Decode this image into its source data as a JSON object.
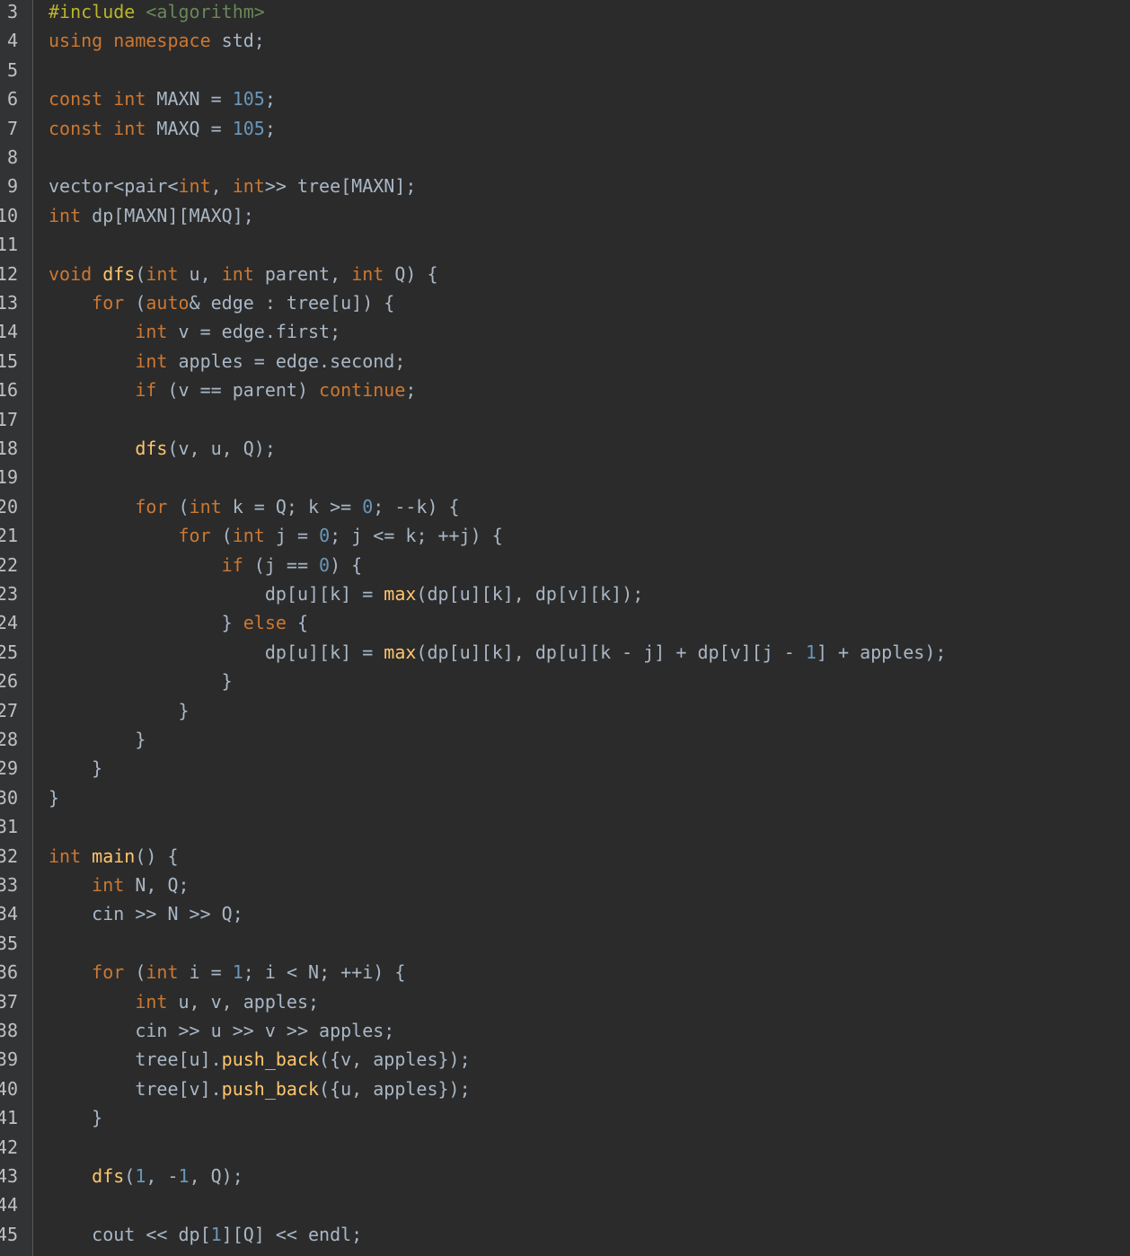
{
  "editor": {
    "line_numbers": [
      "3",
      "4",
      "5",
      "6",
      "7",
      "8",
      "9",
      "10",
      "11",
      "12",
      "13",
      "14",
      "15",
      "16",
      "17",
      "18",
      "19",
      "20",
      "21",
      "22",
      "23",
      "24",
      "25",
      "26",
      "27",
      "28",
      "29",
      "30",
      "31",
      "32",
      "33",
      "34",
      "35",
      "36",
      "37",
      "38",
      "39",
      "40",
      "41",
      "42",
      "43",
      "44",
      "45"
    ],
    "colors": {
      "background": "#2b2b2b",
      "gutter": "#313335",
      "keyword": "#cc7832",
      "number": "#6897bb",
      "function": "#ffc66d",
      "preprocessor": "#bbb529",
      "include_path": "#6a8759",
      "text": "#a9b7c6",
      "line_number": "#c0c0c0"
    },
    "lines": [
      [
        [
          "pre",
          "#include"
        ],
        [
          "txt",
          " "
        ],
        [
          "str",
          "<algorithm>"
        ]
      ],
      [
        [
          "kw",
          "using"
        ],
        [
          "txt",
          " "
        ],
        [
          "kw",
          "namespace"
        ],
        [
          "txt",
          " std;"
        ]
      ],
      [],
      [
        [
          "kw",
          "const"
        ],
        [
          "txt",
          " "
        ],
        [
          "kw",
          "int"
        ],
        [
          "txt",
          " MAXN = "
        ],
        [
          "num",
          "105"
        ],
        [
          "txt",
          ";"
        ]
      ],
      [
        [
          "kw",
          "const"
        ],
        [
          "txt",
          " "
        ],
        [
          "kw",
          "int"
        ],
        [
          "txt",
          " MAXQ = "
        ],
        [
          "num",
          "105"
        ],
        [
          "txt",
          ";"
        ]
      ],
      [],
      [
        [
          "txt",
          "vector<pair<"
        ],
        [
          "kw",
          "int"
        ],
        [
          "txt",
          ", "
        ],
        [
          "kw",
          "int"
        ],
        [
          "txt",
          ">> tree[MAXN];"
        ]
      ],
      [
        [
          "kw",
          "int"
        ],
        [
          "txt",
          " dp[MAXN][MAXQ];"
        ]
      ],
      [],
      [
        [
          "kw",
          "void"
        ],
        [
          "txt",
          " "
        ],
        [
          "fn",
          "dfs"
        ],
        [
          "txt",
          "("
        ],
        [
          "kw",
          "int"
        ],
        [
          "txt",
          " u, "
        ],
        [
          "kw",
          "int"
        ],
        [
          "txt",
          " parent, "
        ],
        [
          "kw",
          "int"
        ],
        [
          "txt",
          " Q) {"
        ]
      ],
      [
        [
          "txt",
          "    "
        ],
        [
          "kw",
          "for"
        ],
        [
          "txt",
          " ("
        ],
        [
          "kw",
          "auto"
        ],
        [
          "txt",
          "& edge : tree[u]) {"
        ]
      ],
      [
        [
          "txt",
          "        "
        ],
        [
          "kw",
          "int"
        ],
        [
          "txt",
          " v = edge.first;"
        ]
      ],
      [
        [
          "txt",
          "        "
        ],
        [
          "kw",
          "int"
        ],
        [
          "txt",
          " apples = edge.second;"
        ]
      ],
      [
        [
          "txt",
          "        "
        ],
        [
          "kw",
          "if"
        ],
        [
          "txt",
          " (v == parent) "
        ],
        [
          "kw",
          "continue"
        ],
        [
          "txt",
          ";"
        ]
      ],
      [],
      [
        [
          "txt",
          "        "
        ],
        [
          "fn",
          "dfs"
        ],
        [
          "txt",
          "(v, u, Q);"
        ]
      ],
      [],
      [
        [
          "txt",
          "        "
        ],
        [
          "kw",
          "for"
        ],
        [
          "txt",
          " ("
        ],
        [
          "kw",
          "int"
        ],
        [
          "txt",
          " k = Q; k >= "
        ],
        [
          "num",
          "0"
        ],
        [
          "txt",
          "; --k) {"
        ]
      ],
      [
        [
          "txt",
          "            "
        ],
        [
          "kw",
          "for"
        ],
        [
          "txt",
          " ("
        ],
        [
          "kw",
          "int"
        ],
        [
          "txt",
          " j = "
        ],
        [
          "num",
          "0"
        ],
        [
          "txt",
          "; j <= k; ++j) {"
        ]
      ],
      [
        [
          "txt",
          "                "
        ],
        [
          "kw",
          "if"
        ],
        [
          "txt",
          " (j == "
        ],
        [
          "num",
          "0"
        ],
        [
          "txt",
          ") {"
        ]
      ],
      [
        [
          "txt",
          "                    dp[u][k] = "
        ],
        [
          "fn",
          "max"
        ],
        [
          "txt",
          "(dp[u][k], dp[v][k]);"
        ]
      ],
      [
        [
          "txt",
          "                } "
        ],
        [
          "kw",
          "else"
        ],
        [
          "txt",
          " {"
        ]
      ],
      [
        [
          "txt",
          "                    dp[u][k] = "
        ],
        [
          "fn",
          "max"
        ],
        [
          "txt",
          "(dp[u][k], dp[u][k - j] + dp[v][j - "
        ],
        [
          "num",
          "1"
        ],
        [
          "txt",
          "] + apples);"
        ]
      ],
      [
        [
          "txt",
          "                }"
        ]
      ],
      [
        [
          "txt",
          "            }"
        ]
      ],
      [
        [
          "txt",
          "        }"
        ]
      ],
      [
        [
          "txt",
          "    }"
        ]
      ],
      [
        [
          "txt",
          "}"
        ]
      ],
      [],
      [
        [
          "kw",
          "int"
        ],
        [
          "txt",
          " "
        ],
        [
          "fn",
          "main"
        ],
        [
          "txt",
          "() {"
        ]
      ],
      [
        [
          "txt",
          "    "
        ],
        [
          "kw",
          "int"
        ],
        [
          "txt",
          " N, Q;"
        ]
      ],
      [
        [
          "txt",
          "    cin >> N >> Q;"
        ]
      ],
      [],
      [
        [
          "txt",
          "    "
        ],
        [
          "kw",
          "for"
        ],
        [
          "txt",
          " ("
        ],
        [
          "kw",
          "int"
        ],
        [
          "txt",
          " i = "
        ],
        [
          "num",
          "1"
        ],
        [
          "txt",
          "; i < N; ++i) {"
        ]
      ],
      [
        [
          "txt",
          "        "
        ],
        [
          "kw",
          "int"
        ],
        [
          "txt",
          " u, v, apples;"
        ]
      ],
      [
        [
          "txt",
          "        cin >> u >> v >> apples;"
        ]
      ],
      [
        [
          "txt",
          "        tree[u]."
        ],
        [
          "fn",
          "push_back"
        ],
        [
          "txt",
          "({v, apples});"
        ]
      ],
      [
        [
          "txt",
          "        tree[v]."
        ],
        [
          "fn",
          "push_back"
        ],
        [
          "txt",
          "({u, apples});"
        ]
      ],
      [
        [
          "txt",
          "    }"
        ]
      ],
      [],
      [
        [
          "txt",
          "    "
        ],
        [
          "fn",
          "dfs"
        ],
        [
          "txt",
          "("
        ],
        [
          "num",
          "1"
        ],
        [
          "txt",
          ", -"
        ],
        [
          "num",
          "1"
        ],
        [
          "txt",
          ", Q);"
        ]
      ],
      [],
      [
        [
          "txt",
          "    cout << dp["
        ],
        [
          "num",
          "1"
        ],
        [
          "txt",
          "][Q] << endl;"
        ]
      ]
    ]
  }
}
